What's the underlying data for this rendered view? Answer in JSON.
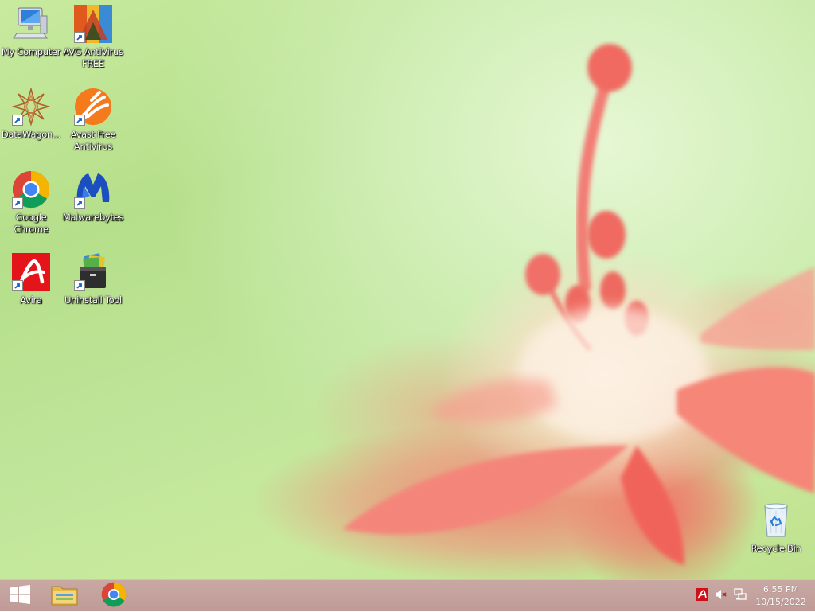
{
  "desktop": {
    "icons": [
      {
        "id": "my-computer",
        "label": "My Computer",
        "icon": "computer-icon",
        "shortcut": false
      },
      {
        "id": "avg",
        "label": "AVG AntiVirus FREE",
        "icon": "avg-icon",
        "shortcut": true
      },
      {
        "id": "datawagon",
        "label": "DataWagon...",
        "icon": "datawagon-icon",
        "shortcut": true
      },
      {
        "id": "avast",
        "label": "Avast Free Antivirus",
        "icon": "avast-icon",
        "shortcut": true
      },
      {
        "id": "chrome",
        "label": "Google Chrome",
        "icon": "chrome-icon",
        "shortcut": true
      },
      {
        "id": "malwarebytes",
        "label": "Malwarebytes",
        "icon": "malwarebytes-icon",
        "shortcut": true
      },
      {
        "id": "avira",
        "label": "Avira",
        "icon": "avira-icon",
        "shortcut": true
      },
      {
        "id": "uninstall-tool",
        "label": "Uninstall Tool",
        "icon": "uninstall-tool-icon",
        "shortcut": true
      }
    ],
    "recycle_bin": {
      "label": "Recycle Bin",
      "icon": "recycle-bin-icon"
    }
  },
  "taskbar": {
    "start_icon": "windows-logo-icon",
    "pinned": [
      {
        "name": "file-explorer",
        "icon": "folder-icon"
      },
      {
        "name": "google-chrome",
        "icon": "chrome-icon"
      }
    ],
    "tray": [
      {
        "name": "avira-tray",
        "icon": "avira-icon"
      },
      {
        "name": "volume-muted",
        "icon": "speaker-muted-icon"
      },
      {
        "name": "network",
        "icon": "network-icon"
      }
    ],
    "clock": {
      "time": "6:55 PM",
      "date": "10/15/2022"
    }
  },
  "colors": {
    "taskbar": "#c5a39f",
    "wallpaper_green": "#c3e69a",
    "flower_pink": "#f07a6e"
  }
}
